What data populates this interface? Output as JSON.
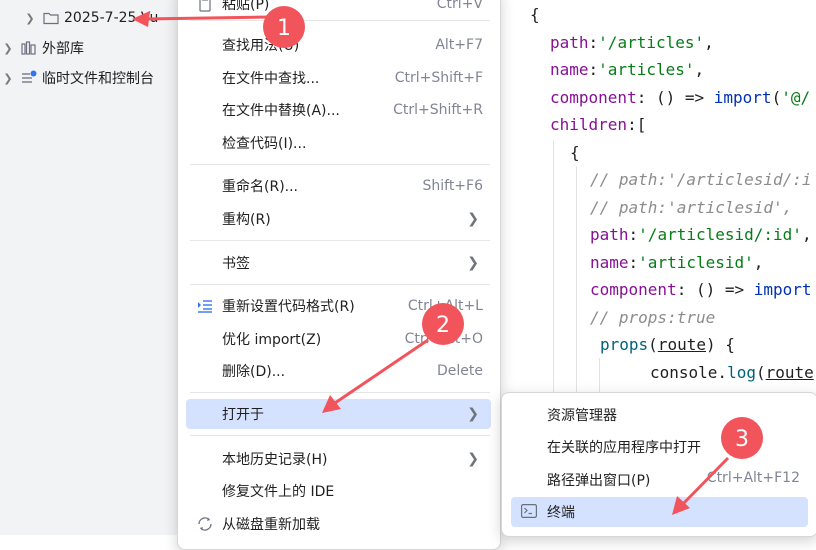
{
  "tree": {
    "items": [
      {
        "label": "2025-7-25 Vu",
        "icon": "folder-icon",
        "expandable": true
      },
      {
        "label": "外部库",
        "icon": "library-icon",
        "expandable": true
      },
      {
        "label": "临时文件和控制台",
        "icon": "scratches-icon",
        "expandable": true
      }
    ]
  },
  "context_menu": {
    "paste": {
      "label": "粘贴(P)",
      "shortcut": "Ctrl+V"
    },
    "find_usages": {
      "label": "查找用法(U)",
      "shortcut": "Alt+F7"
    },
    "find_in_files": {
      "label": "在文件中查找...",
      "shortcut": "Ctrl+Shift+F"
    },
    "replace_in_files": {
      "label": "在文件中替换(A)...",
      "shortcut": "Ctrl+Shift+R"
    },
    "inspect_code": {
      "label": "检查代码(I)..."
    },
    "rename": {
      "label": "重命名(R)...",
      "shortcut": "Shift+F6"
    },
    "refactor": {
      "label": "重构(R)"
    },
    "bookmarks": {
      "label": "书签"
    },
    "reformat": {
      "label": "重新设置代码格式(R)",
      "shortcut": "Ctrl+Alt+L"
    },
    "optimize_imports": {
      "label": "优化 import(Z)",
      "shortcut": "Ctrl+Alt+O"
    },
    "delete": {
      "label": "删除(D)...",
      "shortcut": "Delete"
    },
    "open_in": {
      "label": "打开于"
    },
    "local_history": {
      "label": "本地历史记录(H)"
    },
    "repair_ide": {
      "label": "修复文件上的 IDE"
    },
    "reload_from_disk": {
      "label": "从磁盘重新加载"
    }
  },
  "submenu": {
    "explorer": {
      "label": "资源管理器"
    },
    "associated_app": {
      "label": "在关联的应用程序中打开"
    },
    "path_popup": {
      "label": "路径弹出窗口(P)",
      "shortcut": "Ctrl+Alt+F12"
    },
    "terminal": {
      "label": "终端"
    }
  },
  "code": {
    "lines": [
      "{",
      "  path:'/articles',",
      "  name:'articles',",
      "  component: () => import('@/",
      "  children:[",
      "    {",
      "      // path:'/articlesid/:i",
      "      // path:'articlesid',",
      "      path:'/articlesid/:id',",
      "      name:'articlesid',",
      "      component: () => import",
      "      // props:true",
      "       props(route) {",
      "          console.log(route"
    ]
  },
  "annotations": {
    "badges": [
      "1",
      "2",
      "3"
    ],
    "color": "#f2545b"
  },
  "colors": {
    "accent_highlight": "#d4e2ff",
    "annotation_red": "#f2545b",
    "string_green": "#067d17",
    "keyword_blue": "#0033b3",
    "property_purple": "#871094"
  }
}
